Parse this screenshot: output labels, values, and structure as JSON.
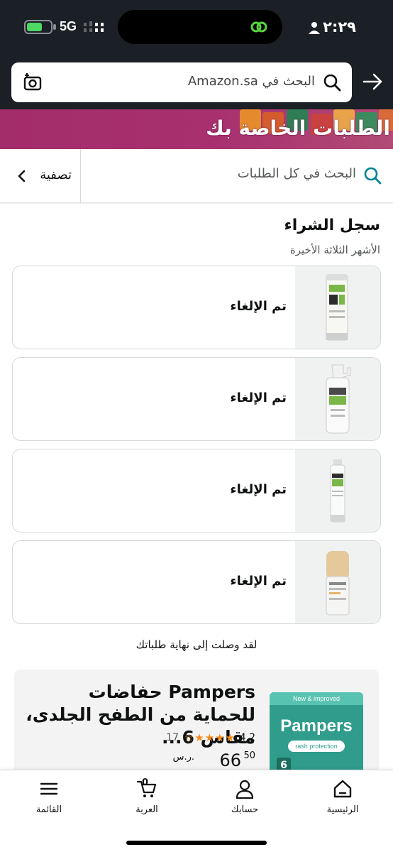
{
  "status_bar": {
    "time": "٢:٢٩",
    "network": "5G",
    "battery_level": 0.65
  },
  "header": {
    "search_placeholder": "البحث في Amazon.sa"
  },
  "banner": {
    "title": "الطلبات الخاصة بك"
  },
  "filter_bar": {
    "search_placeholder": "البحث في كل الطلبات",
    "filter_label": "تصفية"
  },
  "purchase_history": {
    "title": "سجل الشراء",
    "subtitle": "الأشهر الثلاثة الأخيرة",
    "orders": [
      {
        "status": "تم الإلغاء",
        "product_icon": "tube-product-icon"
      },
      {
        "status": "تم الإلغاء",
        "product_icon": "foam-bottle-product-icon"
      },
      {
        "status": "تم الإلغاء",
        "product_icon": "slim-tube-product-icon"
      },
      {
        "status": "تم الإلغاء",
        "product_icon": "foundation-bottle-product-icon"
      }
    ],
    "end_message": "لقد وصلت إلى نهاية طلباتك"
  },
  "ad": {
    "title": "Pampers حفاضات للحماية من الطفح الجلدى، مقاس 6...",
    "rating": "4.2",
    "stars": 4,
    "review_count": "17",
    "price_currency": "ر.س.",
    "price_whole": "66",
    "price_fraction": "50",
    "image_badge": "New & improved",
    "image_brand": "Pampers",
    "image_sub": "rash protection",
    "image_size": "6"
  },
  "bottom_nav": {
    "home": "الرئيسية",
    "account": "حسابك",
    "cart": "العربة",
    "cart_count": "0",
    "menu": "القائمة"
  },
  "colors": {
    "header_bg": "#1b1f26",
    "banner_bg": "#a8306f",
    "search_accent": "#008296",
    "star": "#f38a17"
  }
}
